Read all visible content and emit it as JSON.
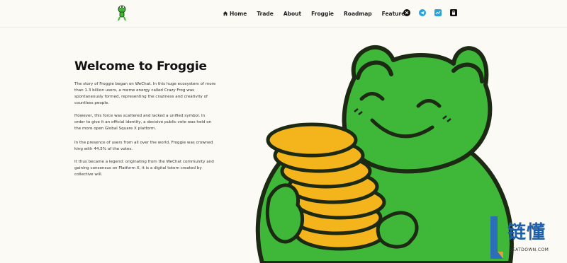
{
  "nav": {
    "home": "Home",
    "trade": "Trade",
    "about": "About",
    "froggie": "Froggie",
    "roadmap": "Roadmap",
    "feature": "Feature"
  },
  "social_icons": [
    "x-icon",
    "telegram-icon",
    "chart-icon",
    "lock-icon"
  ],
  "hero": {
    "title": "Welcome to Froggie",
    "paragraphs": [
      "The story of Froggie began on WeChat. In this huge ecosystem of more than 1.3 billion users, a meme energy called Crazy Frog was spontaneously formed, representing the craziness and creativity of countless people.",
      "However, this force was scattered and lacked a unified symbol. In order to give it an official identity, a decisive public vote was held on the more open Global Square X platform.",
      "In the presence of users from all over the world, Froggie was crowned king with 44.5% of the votes.",
      "It thus became a legend: originating from the WeChat community and gaining consensus on Platform X, it is a digital totem created by collective will."
    ]
  },
  "colors": {
    "background": "#fbfaf4",
    "frog_green": "#3fb83a",
    "frog_outline": "#1c2a14",
    "coin_gold": "#f4b41c",
    "telegram_blue": "#2aa3dc"
  },
  "watermark": {
    "cn": "链懂",
    "en": "NEATDOWN.COM"
  }
}
